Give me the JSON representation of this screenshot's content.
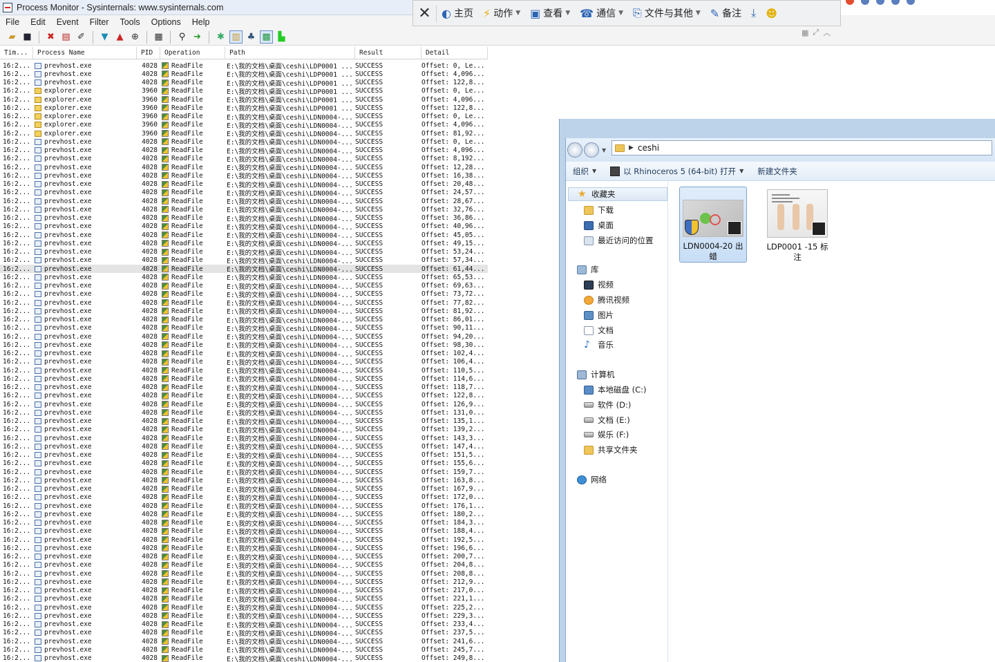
{
  "procmon": {
    "title": "Process Monitor - Sysinternals: www.sysinternals.com",
    "menu": [
      "File",
      "Edit",
      "Event",
      "Filter",
      "Tools",
      "Options",
      "Help"
    ],
    "columns": [
      "Tim...",
      "Process Name",
      "PID",
      "Operation",
      "Path",
      "Result",
      "Detail"
    ],
    "rows": [
      {
        "time": "16:2...",
        "proc": "prevhost.exe",
        "pid": "4028",
        "op": "ReadFile",
        "path": "E:\\我的文档\\桌面\\ceshi\\LDP0001 ...",
        "res": "SUCCESS",
        "det": "Offset: 0, Le..."
      },
      {
        "time": "16:2...",
        "proc": "prevhost.exe",
        "pid": "4028",
        "op": "ReadFile",
        "path": "E:\\我的文档\\桌面\\ceshi\\LDP0001 ...",
        "res": "SUCCESS",
        "det": "Offset: 4,096..."
      },
      {
        "time": "16:2...",
        "proc": "prevhost.exe",
        "pid": "4028",
        "op": "ReadFile",
        "path": "E:\\我的文档\\桌面\\ceshi\\LDP0001 ...",
        "res": "SUCCESS",
        "det": "Offset: 122,8..."
      },
      {
        "time": "16:2...",
        "proc": "explorer.exe",
        "pid": "3960",
        "op": "ReadFile",
        "path": "E:\\我的文档\\桌面\\ceshi\\LDP0001 ...",
        "res": "SUCCESS",
        "det": "Offset: 0, Le..."
      },
      {
        "time": "16:2...",
        "proc": "explorer.exe",
        "pid": "3960",
        "op": "ReadFile",
        "path": "E:\\我的文档\\桌面\\ceshi\\LDP0001 ...",
        "res": "SUCCESS",
        "det": "Offset: 4,096..."
      },
      {
        "time": "16:2...",
        "proc": "explorer.exe",
        "pid": "3960",
        "op": "ReadFile",
        "path": "E:\\我的文档\\桌面\\ceshi\\LDP0001 ...",
        "res": "SUCCESS",
        "det": "Offset: 122,8..."
      },
      {
        "time": "16:2...",
        "proc": "explorer.exe",
        "pid": "3960",
        "op": "ReadFile",
        "path": "E:\\我的文档\\桌面\\ceshi\\LDN0004-...",
        "res": "SUCCESS",
        "det": "Offset: 0, Le..."
      },
      {
        "time": "16:2...",
        "proc": "explorer.exe",
        "pid": "3960",
        "op": "ReadFile",
        "path": "E:\\我的文档\\桌面\\ceshi\\LDN0004-...",
        "res": "SUCCESS",
        "det": "Offset: 4,096..."
      },
      {
        "time": "16:2...",
        "proc": "explorer.exe",
        "pid": "3960",
        "op": "ReadFile",
        "path": "E:\\我的文档\\桌面\\ceshi\\LDN0004-...",
        "res": "SUCCESS",
        "det": "Offset: 81,92..."
      },
      {
        "time": "16:2...",
        "proc": "prevhost.exe",
        "pid": "4028",
        "op": "ReadFile",
        "path": "E:\\我的文档\\桌面\\ceshi\\LDN0004-...",
        "res": "SUCCESS",
        "det": "Offset: 0, Le..."
      },
      {
        "time": "16:2...",
        "proc": "prevhost.exe",
        "pid": "4028",
        "op": "ReadFile",
        "path": "E:\\我的文档\\桌面\\ceshi\\LDN0004-...",
        "res": "SUCCESS",
        "det": "Offset: 4,096..."
      },
      {
        "time": "16:2...",
        "proc": "prevhost.exe",
        "pid": "4028",
        "op": "ReadFile",
        "path": "E:\\我的文档\\桌面\\ceshi\\LDN0004-...",
        "res": "SUCCESS",
        "det": "Offset: 8,192..."
      },
      {
        "time": "16:2...",
        "proc": "prevhost.exe",
        "pid": "4028",
        "op": "ReadFile",
        "path": "E:\\我的文档\\桌面\\ceshi\\LDN0004-...",
        "res": "SUCCESS",
        "det": "Offset: 12,28..."
      },
      {
        "time": "16:2...",
        "proc": "prevhost.exe",
        "pid": "4028",
        "op": "ReadFile",
        "path": "E:\\我的文档\\桌面\\ceshi\\LDN0004-...",
        "res": "SUCCESS",
        "det": "Offset: 16,38..."
      },
      {
        "time": "16:2...",
        "proc": "prevhost.exe",
        "pid": "4028",
        "op": "ReadFile",
        "path": "E:\\我的文档\\桌面\\ceshi\\LDN0004-...",
        "res": "SUCCESS",
        "det": "Offset: 20,48..."
      },
      {
        "time": "16:2...",
        "proc": "prevhost.exe",
        "pid": "4028",
        "op": "ReadFile",
        "path": "E:\\我的文档\\桌面\\ceshi\\LDN0004-...",
        "res": "SUCCESS",
        "det": "Offset: 24,57..."
      },
      {
        "time": "16:2...",
        "proc": "prevhost.exe",
        "pid": "4028",
        "op": "ReadFile",
        "path": "E:\\我的文档\\桌面\\ceshi\\LDN0004-...",
        "res": "SUCCESS",
        "det": "Offset: 28,67..."
      },
      {
        "time": "16:2...",
        "proc": "prevhost.exe",
        "pid": "4028",
        "op": "ReadFile",
        "path": "E:\\我的文档\\桌面\\ceshi\\LDN0004-...",
        "res": "SUCCESS",
        "det": "Offset: 32,76..."
      },
      {
        "time": "16:2...",
        "proc": "prevhost.exe",
        "pid": "4028",
        "op": "ReadFile",
        "path": "E:\\我的文档\\桌面\\ceshi\\LDN0004-...",
        "res": "SUCCESS",
        "det": "Offset: 36,86..."
      },
      {
        "time": "16:2...",
        "proc": "prevhost.exe",
        "pid": "4028",
        "op": "ReadFile",
        "path": "E:\\我的文档\\桌面\\ceshi\\LDN0004-...",
        "res": "SUCCESS",
        "det": "Offset: 40,96..."
      },
      {
        "time": "16:2...",
        "proc": "prevhost.exe",
        "pid": "4028",
        "op": "ReadFile",
        "path": "E:\\我的文档\\桌面\\ceshi\\LDN0004-...",
        "res": "SUCCESS",
        "det": "Offset: 45,05..."
      },
      {
        "time": "16:2...",
        "proc": "prevhost.exe",
        "pid": "4028",
        "op": "ReadFile",
        "path": "E:\\我的文档\\桌面\\ceshi\\LDN0004-...",
        "res": "SUCCESS",
        "det": "Offset: 49,15..."
      },
      {
        "time": "16:2...",
        "proc": "prevhost.exe",
        "pid": "4028",
        "op": "ReadFile",
        "path": "E:\\我的文档\\桌面\\ceshi\\LDN0004-...",
        "res": "SUCCESS",
        "det": "Offset: 53,24..."
      },
      {
        "time": "16:2...",
        "proc": "prevhost.exe",
        "pid": "4028",
        "op": "ReadFile",
        "path": "E:\\我的文档\\桌面\\ceshi\\LDN0004-...",
        "res": "SUCCESS",
        "det": "Offset: 57,34..."
      },
      {
        "time": "16:2...",
        "proc": "prevhost.exe",
        "pid": "4028",
        "op": "ReadFile",
        "path": "E:\\我的文档\\桌面\\ceshi\\LDN0004-...",
        "res": "SUCCESS",
        "det": "Offset: 61,44...",
        "selected": true
      },
      {
        "time": "16:2...",
        "proc": "prevhost.exe",
        "pid": "4028",
        "op": "ReadFile",
        "path": "E:\\我的文档\\桌面\\ceshi\\LDN0004-...",
        "res": "SUCCESS",
        "det": "Offset: 65,53..."
      },
      {
        "time": "16:2...",
        "proc": "prevhost.exe",
        "pid": "4028",
        "op": "ReadFile",
        "path": "E:\\我的文档\\桌面\\ceshi\\LDN0004-...",
        "res": "SUCCESS",
        "det": "Offset: 69,63..."
      },
      {
        "time": "16:2...",
        "proc": "prevhost.exe",
        "pid": "4028",
        "op": "ReadFile",
        "path": "E:\\我的文档\\桌面\\ceshi\\LDN0004-...",
        "res": "SUCCESS",
        "det": "Offset: 73,72..."
      },
      {
        "time": "16:2...",
        "proc": "prevhost.exe",
        "pid": "4028",
        "op": "ReadFile",
        "path": "E:\\我的文档\\桌面\\ceshi\\LDN0004-...",
        "res": "SUCCESS",
        "det": "Offset: 77,82..."
      },
      {
        "time": "16:2...",
        "proc": "prevhost.exe",
        "pid": "4028",
        "op": "ReadFile",
        "path": "E:\\我的文档\\桌面\\ceshi\\LDN0004-...",
        "res": "SUCCESS",
        "det": "Offset: 81,92..."
      },
      {
        "time": "16:2...",
        "proc": "prevhost.exe",
        "pid": "4028",
        "op": "ReadFile",
        "path": "E:\\我的文档\\桌面\\ceshi\\LDN0004-...",
        "res": "SUCCESS",
        "det": "Offset: 86,01..."
      },
      {
        "time": "16:2...",
        "proc": "prevhost.exe",
        "pid": "4028",
        "op": "ReadFile",
        "path": "E:\\我的文档\\桌面\\ceshi\\LDN0004-...",
        "res": "SUCCESS",
        "det": "Offset: 90,11..."
      },
      {
        "time": "16:2...",
        "proc": "prevhost.exe",
        "pid": "4028",
        "op": "ReadFile",
        "path": "E:\\我的文档\\桌面\\ceshi\\LDN0004-...",
        "res": "SUCCESS",
        "det": "Offset: 94,20..."
      },
      {
        "time": "16:2...",
        "proc": "prevhost.exe",
        "pid": "4028",
        "op": "ReadFile",
        "path": "E:\\我的文档\\桌面\\ceshi\\LDN0004-...",
        "res": "SUCCESS",
        "det": "Offset: 98,30..."
      },
      {
        "time": "16:2...",
        "proc": "prevhost.exe",
        "pid": "4028",
        "op": "ReadFile",
        "path": "E:\\我的文档\\桌面\\ceshi\\LDN0004-...",
        "res": "SUCCESS",
        "det": "Offset: 102,4..."
      },
      {
        "time": "16:2...",
        "proc": "prevhost.exe",
        "pid": "4028",
        "op": "ReadFile",
        "path": "E:\\我的文档\\桌面\\ceshi\\LDN0004-...",
        "res": "SUCCESS",
        "det": "Offset: 106,4..."
      },
      {
        "time": "16:2...",
        "proc": "prevhost.exe",
        "pid": "4028",
        "op": "ReadFile",
        "path": "E:\\我的文档\\桌面\\ceshi\\LDN0004-...",
        "res": "SUCCESS",
        "det": "Offset: 110,5..."
      },
      {
        "time": "16:2...",
        "proc": "prevhost.exe",
        "pid": "4028",
        "op": "ReadFile",
        "path": "E:\\我的文档\\桌面\\ceshi\\LDN0004-...",
        "res": "SUCCESS",
        "det": "Offset: 114,6..."
      },
      {
        "time": "16:2...",
        "proc": "prevhost.exe",
        "pid": "4028",
        "op": "ReadFile",
        "path": "E:\\我的文档\\桌面\\ceshi\\LDN0004-...",
        "res": "SUCCESS",
        "det": "Offset: 118,7..."
      },
      {
        "time": "16:2...",
        "proc": "prevhost.exe",
        "pid": "4028",
        "op": "ReadFile",
        "path": "E:\\我的文档\\桌面\\ceshi\\LDN0004-...",
        "res": "SUCCESS",
        "det": "Offset: 122,8..."
      },
      {
        "time": "16:2...",
        "proc": "prevhost.exe",
        "pid": "4028",
        "op": "ReadFile",
        "path": "E:\\我的文档\\桌面\\ceshi\\LDN0004-...",
        "res": "SUCCESS",
        "det": "Offset: 126,9..."
      },
      {
        "time": "16:2...",
        "proc": "prevhost.exe",
        "pid": "4028",
        "op": "ReadFile",
        "path": "E:\\我的文档\\桌面\\ceshi\\LDN0004-...",
        "res": "SUCCESS",
        "det": "Offset: 131,0..."
      },
      {
        "time": "16:2...",
        "proc": "prevhost.exe",
        "pid": "4028",
        "op": "ReadFile",
        "path": "E:\\我的文档\\桌面\\ceshi\\LDN0004-...",
        "res": "SUCCESS",
        "det": "Offset: 135,1..."
      },
      {
        "time": "16:2...",
        "proc": "prevhost.exe",
        "pid": "4028",
        "op": "ReadFile",
        "path": "E:\\我的文档\\桌面\\ceshi\\LDN0004-...",
        "res": "SUCCESS",
        "det": "Offset: 139,2..."
      },
      {
        "time": "16:2...",
        "proc": "prevhost.exe",
        "pid": "4028",
        "op": "ReadFile",
        "path": "E:\\我的文档\\桌面\\ceshi\\LDN0004-...",
        "res": "SUCCESS",
        "det": "Offset: 143,3..."
      },
      {
        "time": "16:2...",
        "proc": "prevhost.exe",
        "pid": "4028",
        "op": "ReadFile",
        "path": "E:\\我的文档\\桌面\\ceshi\\LDN0004-...",
        "res": "SUCCESS",
        "det": "Offset: 147,4..."
      },
      {
        "time": "16:2...",
        "proc": "prevhost.exe",
        "pid": "4028",
        "op": "ReadFile",
        "path": "E:\\我的文档\\桌面\\ceshi\\LDN0004-...",
        "res": "SUCCESS",
        "det": "Offset: 151,5..."
      },
      {
        "time": "16:2...",
        "proc": "prevhost.exe",
        "pid": "4028",
        "op": "ReadFile",
        "path": "E:\\我的文档\\桌面\\ceshi\\LDN0004-...",
        "res": "SUCCESS",
        "det": "Offset: 155,6..."
      },
      {
        "time": "16:2...",
        "proc": "prevhost.exe",
        "pid": "4028",
        "op": "ReadFile",
        "path": "E:\\我的文档\\桌面\\ceshi\\LDN0004-...",
        "res": "SUCCESS",
        "det": "Offset: 159,7..."
      },
      {
        "time": "16:2...",
        "proc": "prevhost.exe",
        "pid": "4028",
        "op": "ReadFile",
        "path": "E:\\我的文档\\桌面\\ceshi\\LDN0004-...",
        "res": "SUCCESS",
        "det": "Offset: 163,8..."
      },
      {
        "time": "16:2...",
        "proc": "prevhost.exe",
        "pid": "4028",
        "op": "ReadFile",
        "path": "E:\\我的文档\\桌面\\ceshi\\LDN0004-...",
        "res": "SUCCESS",
        "det": "Offset: 167,9..."
      },
      {
        "time": "16:2...",
        "proc": "prevhost.exe",
        "pid": "4028",
        "op": "ReadFile",
        "path": "E:\\我的文档\\桌面\\ceshi\\LDN0004-...",
        "res": "SUCCESS",
        "det": "Offset: 172,0..."
      },
      {
        "time": "16:2...",
        "proc": "prevhost.exe",
        "pid": "4028",
        "op": "ReadFile",
        "path": "E:\\我的文档\\桌面\\ceshi\\LDN0004-...",
        "res": "SUCCESS",
        "det": "Offset: 176,1..."
      },
      {
        "time": "16:2...",
        "proc": "prevhost.exe",
        "pid": "4028",
        "op": "ReadFile",
        "path": "E:\\我的文档\\桌面\\ceshi\\LDN0004-...",
        "res": "SUCCESS",
        "det": "Offset: 180,2..."
      },
      {
        "time": "16:2...",
        "proc": "prevhost.exe",
        "pid": "4028",
        "op": "ReadFile",
        "path": "E:\\我的文档\\桌面\\ceshi\\LDN0004-...",
        "res": "SUCCESS",
        "det": "Offset: 184,3..."
      },
      {
        "time": "16:2...",
        "proc": "prevhost.exe",
        "pid": "4028",
        "op": "ReadFile",
        "path": "E:\\我的文档\\桌面\\ceshi\\LDN0004-...",
        "res": "SUCCESS",
        "det": "Offset: 188,4..."
      },
      {
        "time": "16:2...",
        "proc": "prevhost.exe",
        "pid": "4028",
        "op": "ReadFile",
        "path": "E:\\我的文档\\桌面\\ceshi\\LDN0004-...",
        "res": "SUCCESS",
        "det": "Offset: 192,5..."
      },
      {
        "time": "16:2...",
        "proc": "prevhost.exe",
        "pid": "4028",
        "op": "ReadFile",
        "path": "E:\\我的文档\\桌面\\ceshi\\LDN0004-...",
        "res": "SUCCESS",
        "det": "Offset: 196,6..."
      },
      {
        "time": "16:2...",
        "proc": "prevhost.exe",
        "pid": "4028",
        "op": "ReadFile",
        "path": "E:\\我的文档\\桌面\\ceshi\\LDN0004-...",
        "res": "SUCCESS",
        "det": "Offset: 200,7..."
      },
      {
        "time": "16:2...",
        "proc": "prevhost.exe",
        "pid": "4028",
        "op": "ReadFile",
        "path": "E:\\我的文档\\桌面\\ceshi\\LDN0004-...",
        "res": "SUCCESS",
        "det": "Offset: 204,8..."
      },
      {
        "time": "16:2...",
        "proc": "prevhost.exe",
        "pid": "4028",
        "op": "ReadFile",
        "path": "E:\\我的文档\\桌面\\ceshi\\LDN0004-...",
        "res": "SUCCESS",
        "det": "Offset: 208,8..."
      },
      {
        "time": "16:2...",
        "proc": "prevhost.exe",
        "pid": "4028",
        "op": "ReadFile",
        "path": "E:\\我的文档\\桌面\\ceshi\\LDN0004-...",
        "res": "SUCCESS",
        "det": "Offset: 212,9..."
      },
      {
        "time": "16:2...",
        "proc": "prevhost.exe",
        "pid": "4028",
        "op": "ReadFile",
        "path": "E:\\我的文档\\桌面\\ceshi\\LDN0004-...",
        "res": "SUCCESS",
        "det": "Offset: 217,0..."
      },
      {
        "time": "16:2...",
        "proc": "prevhost.exe",
        "pid": "4028",
        "op": "ReadFile",
        "path": "E:\\我的文档\\桌面\\ceshi\\LDN0004-...",
        "res": "SUCCESS",
        "det": "Offset: 221,1..."
      },
      {
        "time": "16:2...",
        "proc": "prevhost.exe",
        "pid": "4028",
        "op": "ReadFile",
        "path": "E:\\我的文档\\桌面\\ceshi\\LDN0004-...",
        "res": "SUCCESS",
        "det": "Offset: 225,2..."
      },
      {
        "time": "16:2...",
        "proc": "prevhost.exe",
        "pid": "4028",
        "op": "ReadFile",
        "path": "E:\\我的文档\\桌面\\ceshi\\LDN0004-...",
        "res": "SUCCESS",
        "det": "Offset: 229,3..."
      },
      {
        "time": "16:2...",
        "proc": "prevhost.exe",
        "pid": "4028",
        "op": "ReadFile",
        "path": "E:\\我的文档\\桌面\\ceshi\\LDN0004-...",
        "res": "SUCCESS",
        "det": "Offset: 233,4..."
      },
      {
        "time": "16:2...",
        "proc": "prevhost.exe",
        "pid": "4028",
        "op": "ReadFile",
        "path": "E:\\我的文档\\桌面\\ceshi\\LDN0004-...",
        "res": "SUCCESS",
        "det": "Offset: 237,5..."
      },
      {
        "time": "16:2...",
        "proc": "prevhost.exe",
        "pid": "4028",
        "op": "ReadFile",
        "path": "E:\\我的文档\\桌面\\ceshi\\LDN0004-...",
        "res": "SUCCESS",
        "det": "Offset: 241,6..."
      },
      {
        "time": "16:2...",
        "proc": "prevhost.exe",
        "pid": "4028",
        "op": "ReadFile",
        "path": "E:\\我的文档\\桌面\\ceshi\\LDN0004-...",
        "res": "SUCCESS",
        "det": "Offset: 245,7..."
      },
      {
        "time": "16:2...",
        "proc": "prevhost.exe",
        "pid": "4028",
        "op": "ReadFile",
        "path": "E:\\我的文档\\桌面\\ceshi\\LDN0004-...",
        "res": "SUCCESS",
        "det": "Offset: 249,8..."
      }
    ]
  },
  "overlay": {
    "items": [
      {
        "label": "主页",
        "icon": "home-icon",
        "glyph": "◐",
        "caret": false
      },
      {
        "label": "动作",
        "icon": "lightning-icon",
        "glyph": "⚡",
        "caret": true
      },
      {
        "label": "查看",
        "icon": "monitor-icon",
        "glyph": "▣",
        "caret": true
      },
      {
        "label": "通信",
        "icon": "phone-icon",
        "glyph": "☎",
        "caret": true
      },
      {
        "label": "文件与其他",
        "icon": "file-transfer-icon",
        "glyph": "⎘",
        "caret": true
      },
      {
        "label": "备注",
        "icon": "note-icon",
        "glyph": "✎",
        "caret": false
      }
    ],
    "download_glyph": "⤓",
    "smile_glyph": "☻"
  },
  "explorer": {
    "path": "ceshi",
    "commands": [
      {
        "label": "组织",
        "caret": true,
        "icon": ""
      },
      {
        "label": "以 Rhinoceros 5 (64-bit) 打开",
        "caret": true,
        "icon": "rhino-icon"
      },
      {
        "label": "新建文件夹",
        "caret": false,
        "icon": ""
      }
    ],
    "nav": {
      "favorites": {
        "label": "收藏夹",
        "items": [
          "下载",
          "桌面",
          "最近访问的位置"
        ]
      },
      "libraries": {
        "label": "库",
        "items": [
          "视频",
          "腾讯视频",
          "图片",
          "文档",
          "音乐"
        ]
      },
      "computer": {
        "label": "计算机",
        "items": [
          "本地磁盘 (C:)",
          "软件 (D:)",
          "文档 (E:)",
          "娱乐 (F:)",
          "共享文件夹"
        ]
      },
      "network": {
        "label": "网络"
      }
    },
    "files": [
      {
        "name": "LDN0004-20 出蜡",
        "selected": true
      },
      {
        "name": "LDP0001 -15 标注",
        "selected": false
      }
    ]
  }
}
